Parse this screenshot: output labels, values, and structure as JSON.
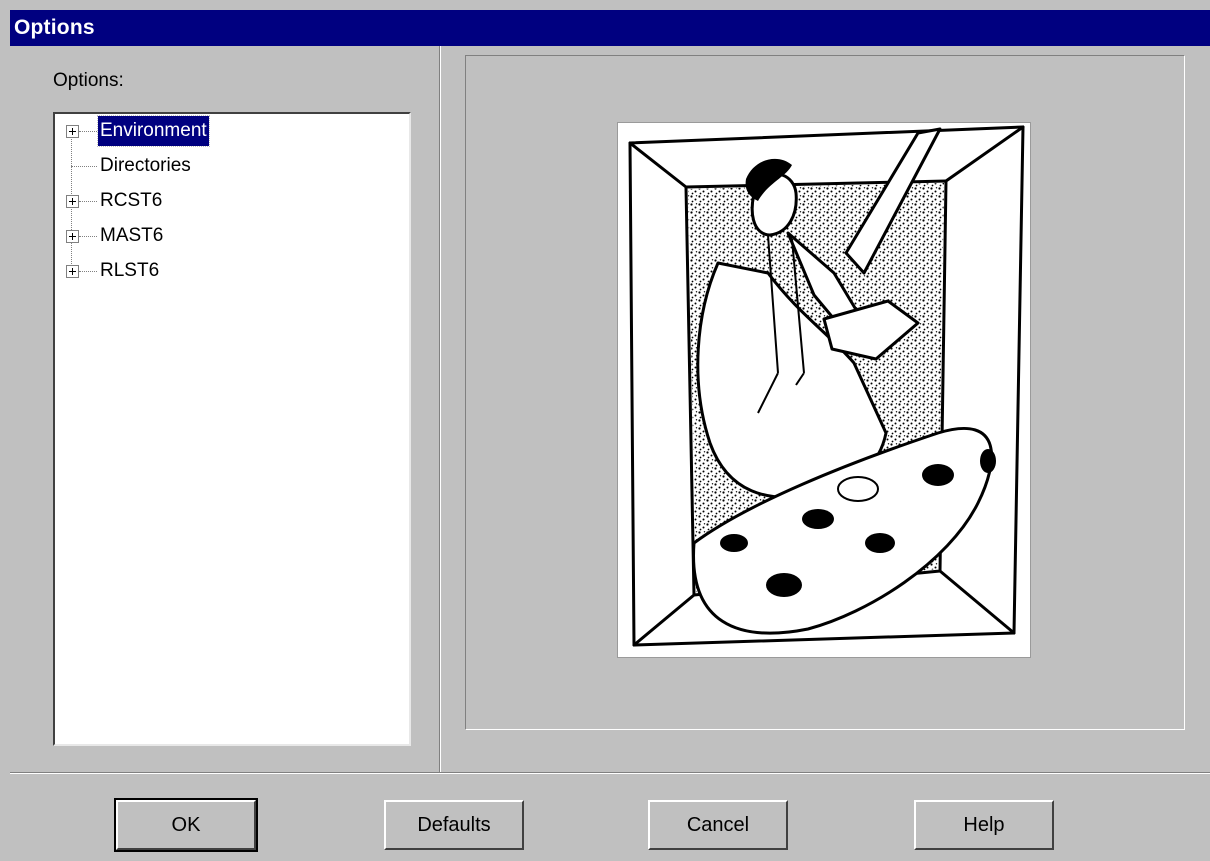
{
  "window": {
    "title": "Options"
  },
  "left_pane": {
    "label": "Options:",
    "tree": [
      {
        "label": "Environment",
        "expandable": true,
        "selected": true
      },
      {
        "label": "Directories",
        "expandable": false,
        "selected": false
      },
      {
        "label": "RCST6",
        "expandable": true,
        "selected": false
      },
      {
        "label": "MAST6",
        "expandable": true,
        "selected": false
      },
      {
        "label": "RLST6",
        "expandable": true,
        "selected": false
      }
    ]
  },
  "preview": {
    "icon": "painter-with-palette-illustration"
  },
  "buttons": {
    "ok": "OK",
    "defaults": "Defaults",
    "cancel": "Cancel",
    "help": "Help"
  },
  "colors": {
    "titlebar": "#000080",
    "face": "#c0c0c0",
    "selection": "#000080"
  }
}
